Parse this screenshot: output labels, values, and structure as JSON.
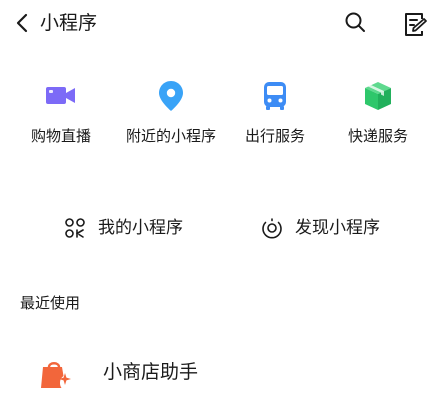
{
  "header": {
    "title": "小程序",
    "back_icon": "chevron-left-icon",
    "search_icon": "search-icon",
    "notes_icon": "edit-notes-icon"
  },
  "services": [
    {
      "label": "购物直播",
      "icon": "video-camera-icon",
      "color": "#7C6AF7"
    },
    {
      "label": "附近的小程序",
      "icon": "location-pin-icon",
      "color": "#39A3F7"
    },
    {
      "label": "出行服务",
      "icon": "bus-icon",
      "color": "#3D8CF5"
    },
    {
      "label": "快递服务",
      "icon": "package-box-icon",
      "color": "#2EC76B"
    }
  ],
  "mini_links": {
    "mine": {
      "label": "我的小程序",
      "icon": "apps-grid-icon"
    },
    "discover": {
      "label": "发现小程序",
      "icon": "discover-icon"
    }
  },
  "recent": {
    "section_title": "最近使用",
    "items": [
      {
        "label": "小商店助手",
        "icon": "shop-bag-icon",
        "color": "#F2663B"
      }
    ]
  }
}
